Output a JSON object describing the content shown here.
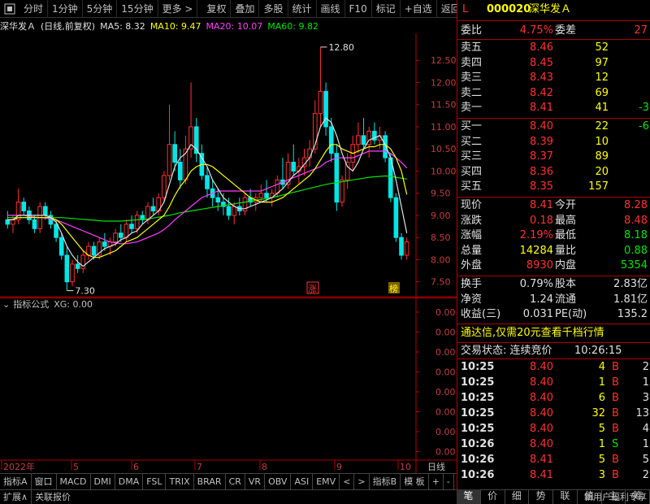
{
  "toolbar": {
    "items": [
      "分时",
      "1分钟",
      "5分钟",
      "15分钟",
      "更多 >",
      "复权",
      "叠加",
      "多股",
      "统计",
      "画线",
      "F10",
      "标记",
      "+自选",
      "返回"
    ]
  },
  "chart_header": {
    "name": "深华发Ａ",
    "mode": "(日线,前复权)",
    "ma5": "MA5: 8.32",
    "ma10": "MA10: 9.47",
    "ma20": "MA20: 10.07",
    "ma60": "MA60: 9.82"
  },
  "chart_data": {
    "type": "candlestick",
    "y_ticks": [
      "12.50",
      "12.00",
      "11.50",
      "11.00",
      "10.50",
      "10.00",
      "9.50",
      "9.00",
      "8.50",
      "8.00",
      "7.50"
    ],
    "ylim": [
      7.2,
      13.0
    ],
    "x_ticks": [
      "2022年",
      "5",
      "6",
      "7",
      "8",
      "9",
      "10"
    ],
    "annotations": {
      "high": "12.80",
      "low": "7.30",
      "flag1": "涨",
      "flag2": "榜"
    },
    "candles": [
      [
        8.9,
        9.1,
        8.7,
        8.8
      ],
      [
        8.8,
        9.0,
        8.6,
        8.9
      ],
      [
        8.9,
        9.6,
        8.8,
        9.3
      ],
      [
        9.3,
        9.4,
        9.0,
        9.1
      ],
      [
        9.1,
        9.2,
        8.8,
        8.9
      ],
      [
        8.9,
        9.0,
        8.6,
        8.7
      ],
      [
        8.7,
        9.3,
        8.6,
        9.2
      ],
      [
        9.2,
        9.3,
        8.9,
        9.0
      ],
      [
        9.0,
        9.1,
        8.7,
        8.8
      ],
      [
        8.8,
        8.9,
        8.4,
        8.5
      ],
      [
        8.5,
        8.6,
        8.0,
        8.1
      ],
      [
        8.1,
        8.3,
        7.3,
        7.5
      ],
      [
        7.5,
        8.0,
        7.4,
        7.9
      ],
      [
        7.9,
        8.1,
        7.7,
        7.8
      ],
      [
        7.8,
        8.2,
        7.7,
        8.1
      ],
      [
        8.1,
        8.4,
        8.0,
        8.3
      ],
      [
        8.3,
        8.4,
        8.0,
        8.1
      ],
      [
        8.1,
        8.5,
        8.0,
        8.4
      ],
      [
        8.4,
        8.6,
        8.2,
        8.3
      ],
      [
        8.3,
        8.5,
        8.1,
        8.4
      ],
      [
        8.4,
        8.7,
        8.3,
        8.6
      ],
      [
        8.6,
        8.8,
        8.4,
        8.5
      ],
      [
        8.5,
        8.9,
        8.4,
        8.8
      ],
      [
        8.8,
        9.0,
        8.6,
        8.7
      ],
      [
        8.7,
        9.1,
        8.6,
        9.0
      ],
      [
        9.0,
        9.1,
        8.8,
        8.9
      ],
      [
        8.9,
        9.3,
        8.8,
        9.2
      ],
      [
        9.2,
        9.4,
        9.0,
        9.1
      ],
      [
        9.1,
        9.5,
        9.0,
        9.4
      ],
      [
        9.4,
        10.0,
        9.3,
        9.9
      ],
      [
        9.9,
        11.5,
        9.8,
        10.6
      ],
      [
        10.6,
        10.9,
        10.0,
        10.2
      ],
      [
        10.2,
        10.5,
        9.6,
        9.8
      ],
      [
        9.8,
        10.8,
        9.7,
        10.5
      ],
      [
        10.5,
        12.0,
        10.3,
        11.0
      ],
      [
        11.0,
        11.2,
        10.2,
        10.4
      ],
      [
        10.4,
        10.6,
        9.8,
        9.9
      ],
      [
        9.9,
        10.1,
        9.4,
        9.6
      ],
      [
        9.6,
        9.8,
        9.2,
        9.4
      ],
      [
        9.4,
        9.6,
        9.1,
        9.3
      ],
      [
        9.3,
        9.5,
        9.0,
        9.2
      ],
      [
        9.2,
        9.4,
        8.9,
        9.0
      ],
      [
        9.0,
        9.3,
        8.8,
        9.2
      ],
      [
        9.2,
        9.4,
        9.0,
        9.1
      ],
      [
        9.1,
        9.5,
        9.0,
        9.4
      ],
      [
        9.4,
        9.6,
        9.2,
        9.3
      ],
      [
        9.3,
        9.5,
        9.1,
        9.4
      ],
      [
        9.4,
        9.7,
        9.3,
        9.5
      ],
      [
        9.5,
        9.8,
        9.3,
        9.4
      ],
      [
        9.4,
        9.6,
        9.2,
        9.5
      ],
      [
        9.5,
        9.9,
        9.4,
        9.8
      ],
      [
        9.8,
        10.3,
        9.6,
        9.7
      ],
      [
        9.7,
        10.4,
        9.6,
        10.2
      ],
      [
        10.2,
        10.6,
        9.9,
        10.0
      ],
      [
        10.0,
        10.3,
        9.7,
        10.1
      ],
      [
        10.1,
        10.5,
        9.9,
        10.3
      ],
      [
        10.3,
        10.7,
        10.1,
        10.5
      ],
      [
        10.5,
        11.6,
        10.4,
        11.3
      ],
      [
        11.3,
        12.8,
        11.0,
        11.8
      ],
      [
        11.8,
        12.0,
        10.8,
        11.0
      ],
      [
        11.0,
        11.2,
        10.2,
        10.4
      ],
      [
        10.4,
        10.6,
        9.1,
        9.3
      ],
      [
        9.3,
        9.9,
        9.2,
        9.8
      ],
      [
        9.8,
        10.4,
        9.6,
        10.2
      ],
      [
        10.2,
        10.8,
        10.0,
        10.6
      ],
      [
        10.6,
        11.1,
        10.4,
        10.8
      ],
      [
        10.8,
        11.2,
        10.5,
        10.6
      ],
      [
        10.6,
        11.0,
        10.3,
        10.9
      ],
      [
        10.9,
        11.1,
        10.6,
        10.7
      ],
      [
        10.7,
        11.0,
        10.5,
        10.8
      ],
      [
        10.8,
        10.9,
        10.2,
        10.3
      ],
      [
        10.3,
        10.4,
        9.3,
        9.4
      ],
      [
        9.4,
        9.5,
        8.4,
        8.5
      ],
      [
        8.5,
        8.6,
        8.0,
        8.1
      ],
      [
        8.1,
        8.5,
        8.0,
        8.4
      ]
    ],
    "ma5": [
      8.9,
      8.9,
      9.0,
      9.0,
      9.0,
      9.0,
      9.0,
      9.0,
      8.95,
      8.85,
      8.6,
      8.3,
      8.1,
      7.95,
      7.85,
      7.95,
      8.05,
      8.15,
      8.25,
      8.3,
      8.35,
      8.45,
      8.5,
      8.6,
      8.65,
      8.8,
      8.9,
      9.0,
      9.1,
      9.3,
      9.7,
      10.1,
      10.3,
      10.4,
      10.6,
      10.5,
      10.3,
      10.1,
      9.8,
      9.6,
      9.4,
      9.3,
      9.2,
      9.15,
      9.15,
      9.2,
      9.25,
      9.3,
      9.35,
      9.4,
      9.5,
      9.6,
      9.75,
      9.9,
      10.0,
      10.15,
      10.3,
      10.6,
      11.0,
      11.2,
      11.1,
      10.8,
      10.4,
      10.1,
      10.0,
      10.2,
      10.5,
      10.7,
      10.75,
      10.8,
      10.6,
      10.3,
      9.8,
      9.2,
      8.6
    ],
    "ma10": [
      8.9,
      8.9,
      8.95,
      8.95,
      8.95,
      8.95,
      8.95,
      8.95,
      8.95,
      8.9,
      8.8,
      8.65,
      8.5,
      8.35,
      8.2,
      8.1,
      8.05,
      8.05,
      8.1,
      8.15,
      8.2,
      8.3,
      8.4,
      8.45,
      8.5,
      8.6,
      8.7,
      8.8,
      8.9,
      9.0,
      9.2,
      9.45,
      9.65,
      9.8,
      10.0,
      10.1,
      10.15,
      10.15,
      10.1,
      10.0,
      9.9,
      9.8,
      9.7,
      9.6,
      9.5,
      9.4,
      9.35,
      9.3,
      9.3,
      9.3,
      9.35,
      9.4,
      9.5,
      9.6,
      9.7,
      9.8,
      9.9,
      10.05,
      10.25,
      10.45,
      10.6,
      10.6,
      10.5,
      10.45,
      10.4,
      10.45,
      10.5,
      10.55,
      10.55,
      10.6,
      10.6,
      10.5,
      10.3,
      10.0,
      9.47
    ],
    "ma20": [
      9.0,
      9.0,
      9.0,
      9.0,
      8.98,
      8.96,
      8.95,
      8.94,
      8.92,
      8.9,
      8.85,
      8.8,
      8.75,
      8.7,
      8.65,
      8.6,
      8.55,
      8.5,
      8.45,
      8.4,
      8.38,
      8.36,
      8.36,
      8.38,
      8.4,
      8.45,
      8.5,
      8.55,
      8.6,
      8.68,
      8.78,
      8.9,
      9.0,
      9.1,
      9.2,
      9.3,
      9.4,
      9.45,
      9.5,
      9.55,
      9.55,
      9.55,
      9.55,
      9.55,
      9.55,
      9.55,
      9.55,
      9.55,
      9.6,
      9.65,
      9.7,
      9.75,
      9.8,
      9.85,
      9.9,
      9.95,
      10.0,
      10.05,
      10.1,
      10.2,
      10.25,
      10.3,
      10.3,
      10.3,
      10.3,
      10.35,
      10.4,
      10.45,
      10.45,
      10.45,
      10.45,
      10.4,
      10.3,
      10.2,
      10.07
    ],
    "ma60": [
      8.95,
      8.95,
      8.95,
      8.95,
      8.95,
      8.95,
      8.95,
      8.95,
      8.95,
      8.95,
      8.95,
      8.94,
      8.93,
      8.92,
      8.91,
      8.9,
      8.89,
      8.88,
      8.87,
      8.87,
      8.87,
      8.87,
      8.88,
      8.89,
      8.9,
      8.91,
      8.92,
      8.94,
      8.96,
      8.98,
      9.0,
      9.03,
      9.06,
      9.08,
      9.1,
      9.12,
      9.14,
      9.16,
      9.18,
      9.2,
      9.22,
      9.24,
      9.26,
      9.28,
      9.3,
      9.32,
      9.34,
      9.36,
      9.38,
      9.4,
      9.43,
      9.46,
      9.49,
      9.52,
      9.55,
      9.58,
      9.61,
      9.64,
      9.67,
      9.7,
      9.72,
      9.74,
      9.76,
      9.78,
      9.8,
      9.82,
      9.84,
      9.86,
      9.87,
      9.88,
      9.89,
      9.88,
      9.86,
      9.84,
      9.82
    ]
  },
  "sub_chart": {
    "label": "指标公式",
    "value": "XG: 0.00",
    "y_ticks": [
      "0.00",
      "0.00",
      "0.00",
      "0.00",
      "0.00",
      "0.00",
      "0.00",
      "0.00"
    ]
  },
  "indicator_tabs": [
    "指标A",
    "窗口",
    "MACD",
    "DMI",
    "DMA",
    "FSL",
    "TRIX",
    "BRAR",
    "CR",
    "VR",
    "OBV",
    "ASI",
    "EMV",
    "<",
    ">",
    "指标B",
    "模 板",
    "+",
    "-"
  ],
  "period": "日线",
  "status_bar": [
    "扩展∧",
    "关联报价"
  ],
  "promo_bottom": "新用户福利专享",
  "quote": {
    "code": "000020",
    "name": "深华发Ａ",
    "flag": "L",
    "weibi_label": "委比",
    "weibi": "4.75%",
    "weicha_label": "委差",
    "weicha": "27",
    "asks": [
      {
        "label": "卖五",
        "price": "8.46",
        "vol": "52",
        "chg": ""
      },
      {
        "label": "卖四",
        "price": "8.45",
        "vol": "97",
        "chg": ""
      },
      {
        "label": "卖三",
        "price": "8.43",
        "vol": "12",
        "chg": ""
      },
      {
        "label": "卖二",
        "price": "8.42",
        "vol": "69",
        "chg": ""
      },
      {
        "label": "卖一",
        "price": "8.41",
        "vol": "41",
        "chg": "-3"
      }
    ],
    "bids": [
      {
        "label": "买一",
        "price": "8.40",
        "vol": "22",
        "chg": "-6"
      },
      {
        "label": "买二",
        "price": "8.39",
        "vol": "10",
        "chg": ""
      },
      {
        "label": "买三",
        "price": "8.37",
        "vol": "89",
        "chg": ""
      },
      {
        "label": "买四",
        "price": "8.36",
        "vol": "20",
        "chg": ""
      },
      {
        "label": "买五",
        "price": "8.35",
        "vol": "157",
        "chg": ""
      }
    ],
    "stats": [
      {
        "l1": "现价",
        "v1": "8.41",
        "c1": "red",
        "l2": "今开",
        "v2": "8.28",
        "c2": "red"
      },
      {
        "l1": "涨跌",
        "v1": "0.18",
        "c1": "red",
        "l2": "最高",
        "v2": "8.48",
        "c2": "red"
      },
      {
        "l1": "涨幅",
        "v1": "2.19%",
        "c1": "red",
        "l2": "最低",
        "v2": "8.18",
        "c2": "grn"
      },
      {
        "l1": "总量",
        "v1": "14284",
        "c1": "yel",
        "l2": "量比",
        "v2": "0.88",
        "c2": "grn"
      },
      {
        "l1": "外盘",
        "v1": "8930",
        "c1": "red",
        "l2": "内盘",
        "v2": "5354",
        "c2": "grn"
      }
    ],
    "stats2": [
      {
        "l1": "换手",
        "v1": "0.79%",
        "l2": "股本",
        "v2": "2.83亿"
      },
      {
        "l1": "净资",
        "v1": "1.24",
        "l2": "流通",
        "v2": "1.81亿"
      },
      {
        "l1": "收益(三)",
        "v1": "0.031",
        "l2": "PE(动)",
        "v2": "135.2"
      }
    ],
    "promo": "通达信,仅需20元查看千档行情",
    "trade_state_label": "交易状态: 连续竞价",
    "trade_time": "10:26:15",
    "ticks": [
      {
        "t": "10:25",
        "p": "8.40",
        "v": "4",
        "s": "B",
        "n": "2"
      },
      {
        "t": "10:25",
        "p": "8.40",
        "v": "1",
        "s": "B",
        "n": "1"
      },
      {
        "t": "10:25",
        "p": "8.40",
        "v": "6",
        "s": "B",
        "n": "3"
      },
      {
        "t": "10:25",
        "p": "8.40",
        "v": "32",
        "s": "B",
        "n": "13"
      },
      {
        "t": "10:25",
        "p": "8.40",
        "v": "5",
        "s": "B",
        "n": "4"
      },
      {
        "t": "10:26",
        "p": "8.40",
        "v": "1",
        "s": "S",
        "n": "1"
      },
      {
        "t": "10:26",
        "p": "8.41",
        "v": "5",
        "s": "B",
        "n": "5"
      },
      {
        "t": "10:26",
        "p": "8.41",
        "v": "3",
        "s": "B",
        "n": "2"
      }
    ],
    "tabs": [
      "笔",
      "价",
      "细",
      "势",
      "联",
      "值",
      "主",
      "筹"
    ]
  },
  "colors": {
    "up": "#ff3232",
    "down": "#00e6e6",
    "ma5": "#e0e0e0",
    "ma10": "#ffff00",
    "ma20": "#ff40ff",
    "ma60": "#00e600",
    "grid": "#b00000"
  }
}
